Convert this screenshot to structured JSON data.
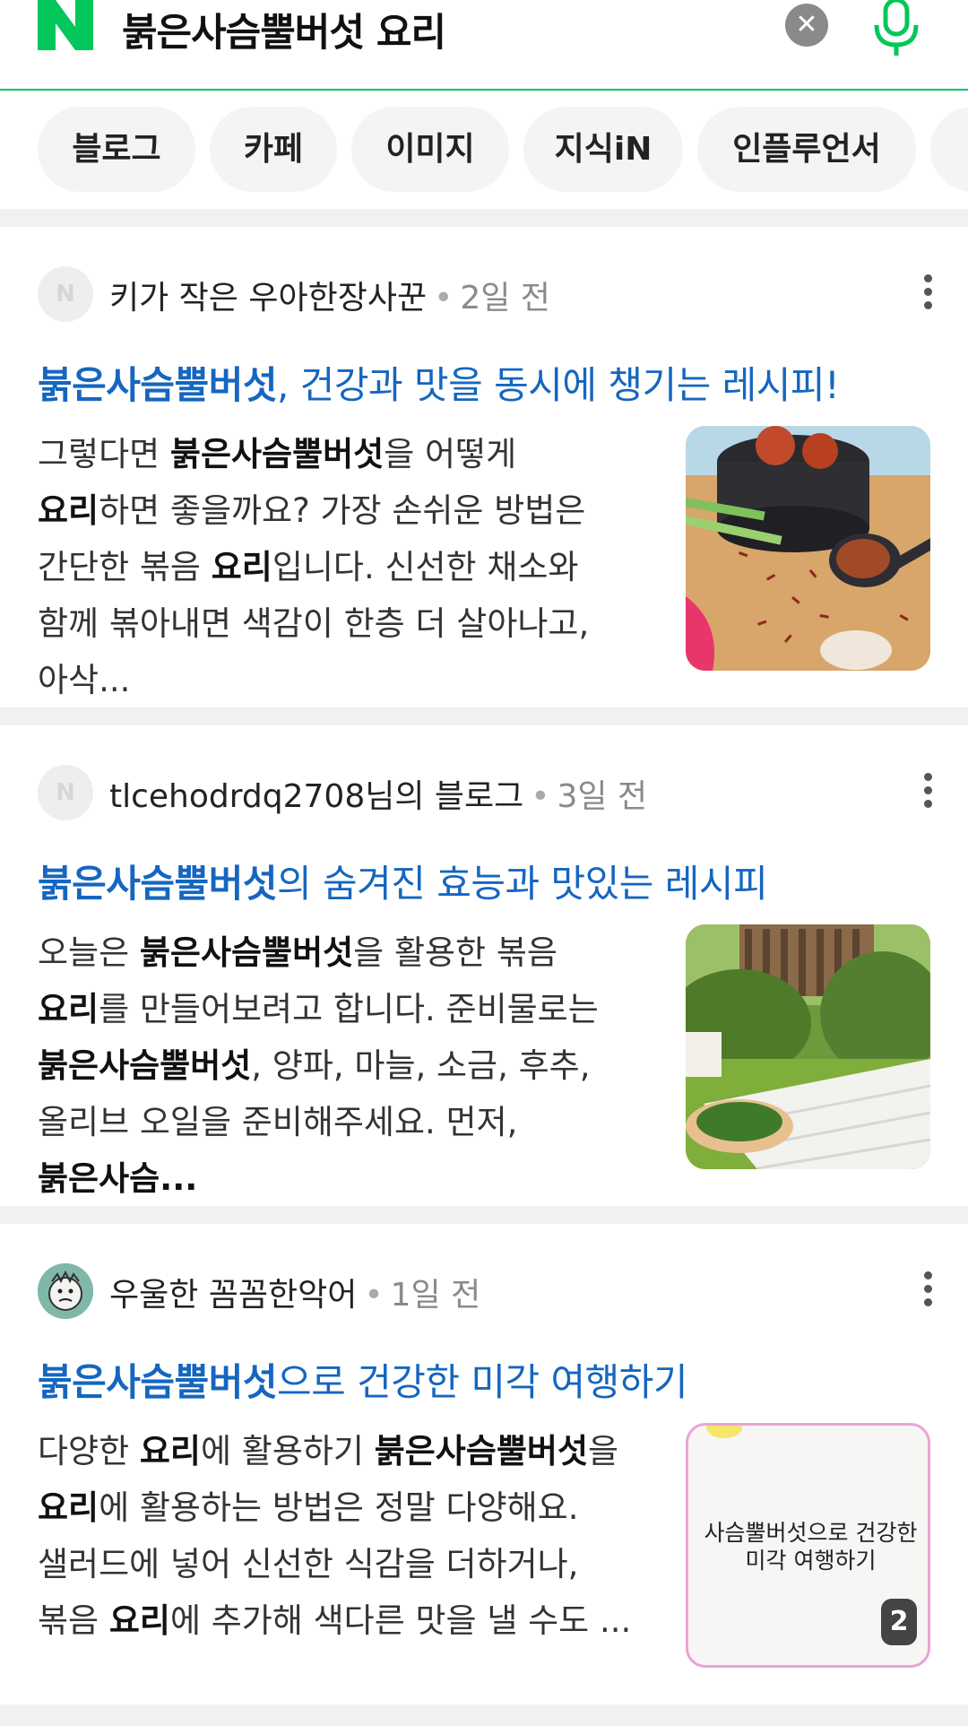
{
  "search": {
    "query": "붉은사슴뿔버섯 요리",
    "clear_icon": "close-icon",
    "mic_icon": "microphone-icon",
    "brand_color": "#03c75a"
  },
  "tabs": [
    {
      "label": "블로그"
    },
    {
      "label": "카페"
    },
    {
      "label": "이미지"
    },
    {
      "label": "지식iN"
    },
    {
      "label": "인플루언서"
    }
  ],
  "results": [
    {
      "author": "키가 작은 우아한장사꾼",
      "time": "2일 전",
      "title_keyword": "붉은사슴뿔버섯",
      "title_rest": ", 건강과 맛을 동시에 챙기는 레시피!",
      "snippet": [
        {
          "t": "그렇다면 ",
          "b": false
        },
        {
          "t": "붉은사슴뿔버섯",
          "b": true
        },
        {
          "t": "을 어떻게 ",
          "b": false
        },
        {
          "t": "요리",
          "b": true
        },
        {
          "t": "하면 좋을까요? 가장 손쉬운 방법은 간단한 볶음 ",
          "b": false
        },
        {
          "t": "요리",
          "b": true
        },
        {
          "t": "입니다. 신선한 채소와 함께 볶아내면 색감이 한층 더 살아나고, 아삭...",
          "b": false
        }
      ]
    },
    {
      "author": "tlcehodrdq2708님의 블로그",
      "time": "3일 전",
      "title_keyword": "붉은사슴뿔버섯",
      "title_rest": "의 숨겨진 효능과 맛있는 레시피",
      "snippet": [
        {
          "t": "오늘은 ",
          "b": false
        },
        {
          "t": "붉은사슴뿔버섯",
          "b": true
        },
        {
          "t": "을 활용한 볶음 ",
          "b": false
        },
        {
          "t": "요리",
          "b": true
        },
        {
          "t": "를 만들어보려고 합니다. 준비물로는 ",
          "b": false
        },
        {
          "t": "붉은사슴뿔버섯",
          "b": true
        },
        {
          "t": ", 양파, 마늘, 소금, 후추, 올리브 오일을 준비해주세요. 먼저, ",
          "b": false
        },
        {
          "t": "붉은사슴...",
          "b": true
        }
      ]
    },
    {
      "author": "우울한 꼼꼼한악어",
      "time": "1일 전",
      "title_keyword": "붉은사슴뿔버섯",
      "title_rest": "으로 건강한 미각 여행하기",
      "snippet": [
        {
          "t": "다양한 ",
          "b": false
        },
        {
          "t": "요리",
          "b": true
        },
        {
          "t": "에 활용하기 ",
          "b": false
        },
        {
          "t": "붉은사슴뿔버섯",
          "b": true
        },
        {
          "t": "을 ",
          "b": false
        },
        {
          "t": "요리",
          "b": true
        },
        {
          "t": "에 활용하는 방법은 정말 다양해요. 샐러드에 넣어 신선한 식감을 더하거나, 볶음 ",
          "b": false
        },
        {
          "t": "요리",
          "b": true
        },
        {
          "t": "에 추가해 색다른 맛을 낼 수도 ...",
          "b": false
        }
      ],
      "thumb_text": "사슴뿔버섯으로 건강한 미각 여행하기",
      "thumb_count": "2"
    }
  ]
}
